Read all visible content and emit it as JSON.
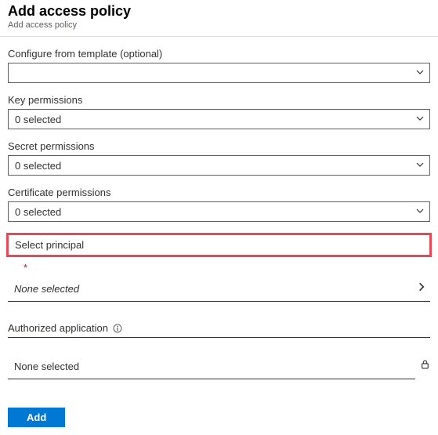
{
  "header": {
    "title": "Add access policy",
    "subtitle": "Add access policy"
  },
  "fields": {
    "template": {
      "label": "Configure from template (optional)",
      "value": ""
    },
    "key": {
      "label": "Key permissions",
      "value": "0 selected"
    },
    "secret": {
      "label": "Secret permissions",
      "value": "0 selected"
    },
    "certificate": {
      "label": "Certificate permissions",
      "value": "0 selected"
    }
  },
  "principal": {
    "label": "Select principal",
    "required": "*",
    "value": "None selected"
  },
  "authorizedApp": {
    "label": "Authorized application",
    "value": "None selected"
  },
  "actions": {
    "add": "Add"
  }
}
